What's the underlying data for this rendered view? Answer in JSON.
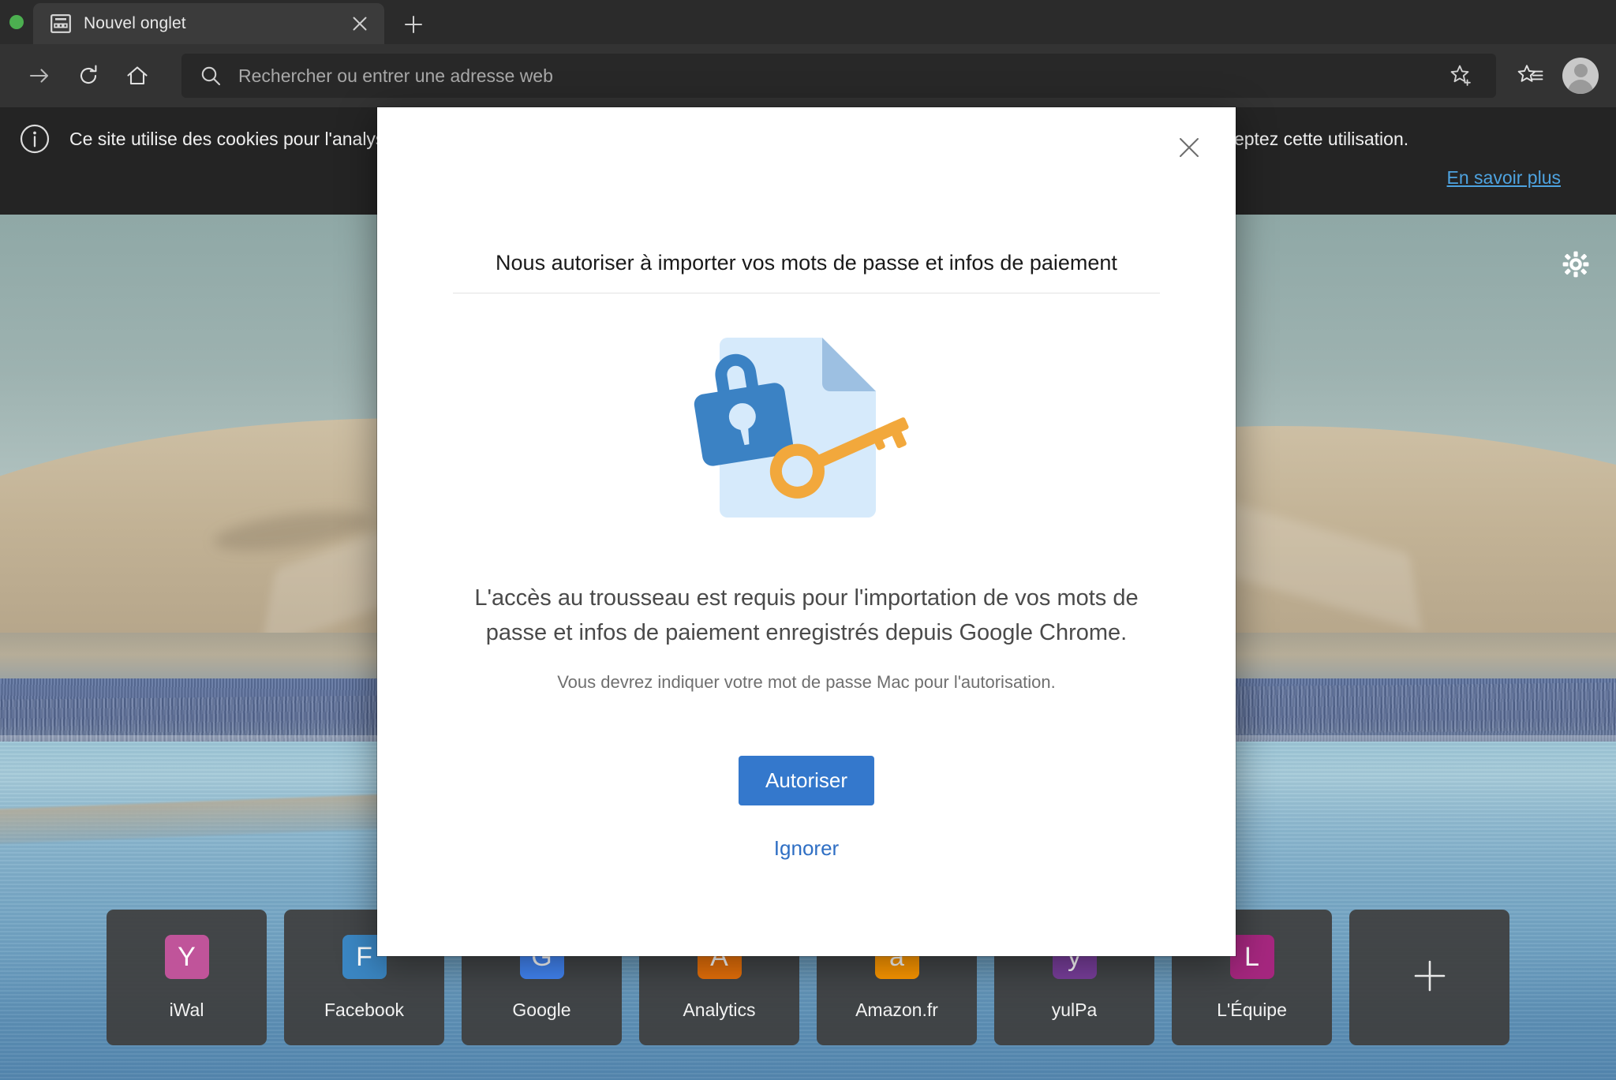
{
  "window": {
    "traffic_light_green": "#4caf50",
    "chrome_bg": "#2b2b2b"
  },
  "tabstrip": {
    "tabs": [
      {
        "title": "Nouvel onglet",
        "favicon": "newtab-grid-icon",
        "close_label": "×"
      }
    ],
    "new_tab_label": "+"
  },
  "toolbar": {
    "forward_label": "→",
    "reload_label": "⟳",
    "home_label": "⌂",
    "search_icon": "search-icon",
    "omnibox_value": "",
    "omnibox_placeholder": "Rechercher ou entrer une adresse web",
    "add_favorite_icon": "star-plus-icon",
    "favorites_icon": "star-list-icon",
    "profile_icon": "avatar-icon"
  },
  "cookie_banner": {
    "info_icon": "info-circle-icon",
    "message": "Ce site utilise des cookies pour l'analyse, ainsi que pour le contenu et les publicités personnalisés. En continuant à naviguer sur ce site, vous acceptez cette utilisation.",
    "learn_more": "En savoir plus",
    "link_color": "#4ea3e0"
  },
  "page": {
    "settings_icon": "gear-icon",
    "tiles": [
      {
        "label": "iWal",
        "glyph": "Y",
        "color": "#c0549a"
      },
      {
        "label": "Facebook",
        "glyph": "F",
        "color": "#3b87c4"
      },
      {
        "label": "Google",
        "glyph": "G",
        "color": "#4285f4"
      },
      {
        "label": "Analytics",
        "glyph": "A",
        "color": "#e8710a"
      },
      {
        "label": "Amazon.fr",
        "glyph": "a",
        "color": "#ff9900"
      },
      {
        "label": "yulPa",
        "glyph": "y",
        "color": "#7a3f9d"
      },
      {
        "label": "L'Équipe",
        "glyph": "L",
        "color": "#a6277f"
      }
    ],
    "add_tile_label": "+"
  },
  "modal": {
    "close_label": "×",
    "title": "Nous autoriser à importer vos mots de passe et infos de paiement",
    "illustration": "lock-key-document-illustration",
    "body": "L'accès au trousseau est requis pour l'importation de vos mots de passe et infos de paiement enregistrés depuis Google Chrome.",
    "subtext": "Vous devrez indiquer votre mot de passe Mac pour l'autorisation.",
    "primary_button": "Autoriser",
    "secondary_link": "Ignorer",
    "primary_color": "#3478cc",
    "link_color": "#2f6fc4"
  }
}
